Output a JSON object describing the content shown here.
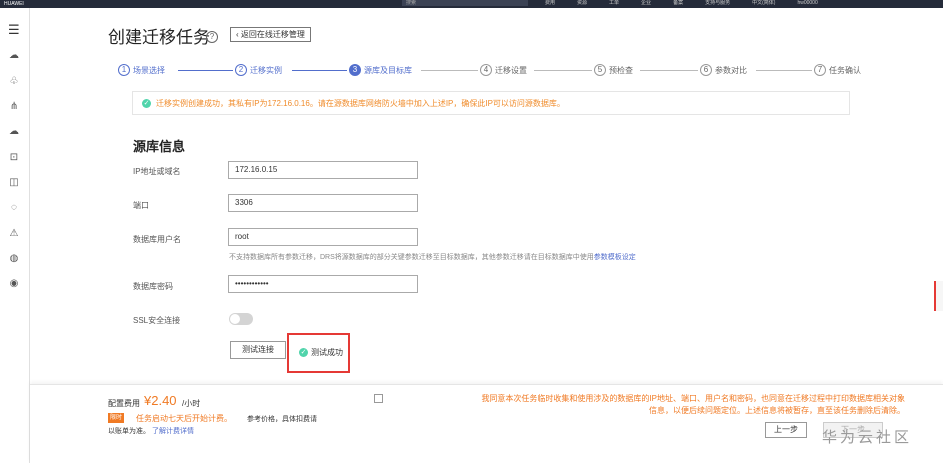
{
  "topbar": {
    "logo": "HUAWEI",
    "search_placeholder": "搜索",
    "nav": [
      "费用",
      "资源",
      "工单",
      "企业",
      "备案",
      "支持与服务",
      "中文(简体)",
      "hw00000"
    ]
  },
  "sidebar": {
    "icons": [
      "menu-icon",
      "cloud-icon",
      "group-icon",
      "network-icon",
      "database-icon",
      "server-icon",
      "chart-icon",
      "cloud-sync-icon",
      "triangle-icon",
      "globe-icon",
      "shield-icon"
    ]
  },
  "page": {
    "title": "创建迁移任务",
    "help_icon": "?",
    "back_label": "返回在线迁移管理"
  },
  "steps": [
    {
      "num": "1",
      "label": "场景选择",
      "state": "done"
    },
    {
      "num": "2",
      "label": "迁移实例",
      "state": "done"
    },
    {
      "num": "3",
      "label": "源库及目标库",
      "state": "active"
    },
    {
      "num": "4",
      "label": "迁移设置",
      "state": "todo"
    },
    {
      "num": "5",
      "label": "预检查",
      "state": "todo"
    },
    {
      "num": "6",
      "label": "参数对比",
      "state": "todo"
    },
    {
      "num": "7",
      "label": "任务确认",
      "state": "todo"
    }
  ],
  "alert": {
    "text": "迁移实例创建成功，其私有IP为172.16.0.16。请在源数据库网络防火墙中加入上述IP，确保此IP可以访问源数据库。"
  },
  "source": {
    "section_title": "源库信息",
    "ip_label": "IP地址或域名",
    "ip_value": "172.16.0.15",
    "port_label": "端口",
    "port_value": "3306",
    "user_label": "数据库用户名",
    "user_value": "root",
    "hint_text": "不支持数据库所有参数迁移，DRS将源数据库的部分关键参数迁移至目标数据库，其他参数迁移请在目标数据库中使用",
    "hint_link": "参数模板设定",
    "password_label": "数据库密码",
    "password_value": "••••••••••••",
    "ssl_label": "SSL安全连接",
    "test_button": "测试连接",
    "test_result": "测试成功"
  },
  "footer": {
    "fee_label": "配置费用",
    "fee_value": "¥2.40",
    "fee_unit": "/小时",
    "free_badge": "限时",
    "free_text": "任务启动七天后开始计费。",
    "ref_text": "参考价格，具体扣费请",
    "ref_text2": "以账单为准。",
    "fee_link": "了解计费详情",
    "agree_line1": "我同意本次任务临时收集和使用涉及的数据库的IP地址、端口、用户名和密码，也同意在迁移过程中打印数据库相关对象",
    "agree_line2": "信息，以便后续问题定位。上述信息将被暂存，直至该任务删除后清除。",
    "prev_button": "上一步",
    "next_button": "下一步"
  },
  "watermark": "华为云社区"
}
